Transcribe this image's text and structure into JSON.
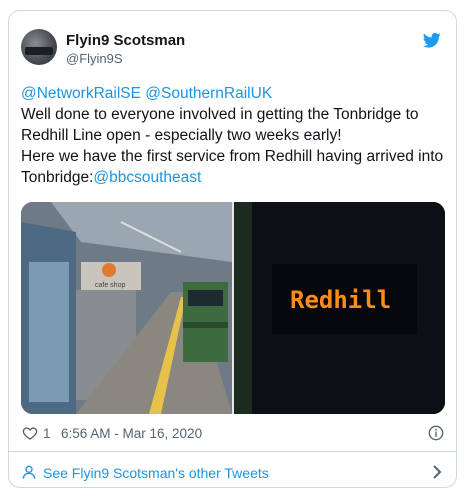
{
  "author": {
    "name": "Flyin9 Scotsman",
    "handle": "@Flyin9S"
  },
  "tweet": {
    "mention_1": "@NetworkRailSE",
    "mention_2": "@SouthernRailUK",
    "line_1": "Well done to everyone involved in getting the Tonbridge to Redhill Line open - especially two weeks early!",
    "line_2": "Here we have the first service from Redhill having arrived into Tonbridge:",
    "mention_3": "@bbcsoutheast"
  },
  "media": {
    "sign_text": "cafe shop",
    "display_text": "Redhill"
  },
  "meta": {
    "likes": "1",
    "timestamp": "6:56 AM - Mar 16, 2020"
  },
  "cta": {
    "label": "See Flyin9 Scotsman's other Tweets"
  },
  "colors": {
    "link": "#1b95e0",
    "display": "#ff8c1a",
    "twitter_blue": "#1d9bf0"
  },
  "icons": [
    "twitter-bird-icon",
    "heart-icon",
    "info-icon",
    "person-icon",
    "chevron-right-icon"
  ]
}
